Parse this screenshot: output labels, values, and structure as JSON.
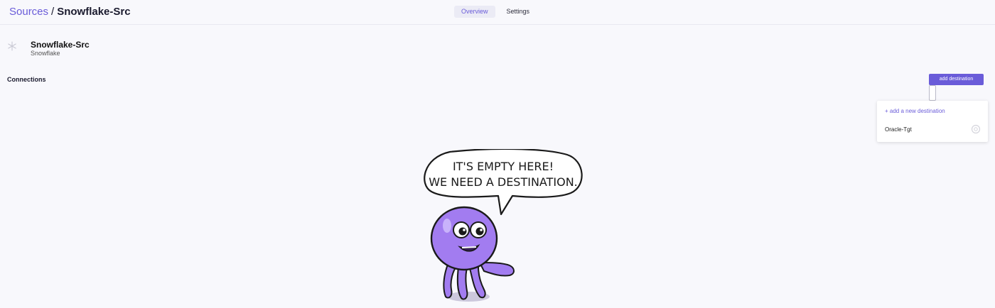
{
  "breadcrumb": {
    "parent": "Sources",
    "separator": "/",
    "current": "Snowflake-Src"
  },
  "tabs": [
    {
      "label": "Overview",
      "active": true
    },
    {
      "label": "Settings",
      "active": false
    }
  ],
  "source": {
    "title": "Snowflake-Src",
    "type": "Snowflake",
    "icon": "snowflake-icon"
  },
  "connections": {
    "label": "Connections",
    "add_button": "add destination"
  },
  "dropdown": {
    "add_new": "+ add a new destination",
    "items": [
      {
        "label": "Oracle-Tgt",
        "icon": "oracle-icon"
      }
    ]
  },
  "empty_state": {
    "line1": "IT'S EMPTY HERE!",
    "line2": "WE NEED A DESTINATION."
  },
  "colors": {
    "accent": "#6a5cd9",
    "background": "#f8f8fc",
    "octopus": "#a27cf0"
  }
}
